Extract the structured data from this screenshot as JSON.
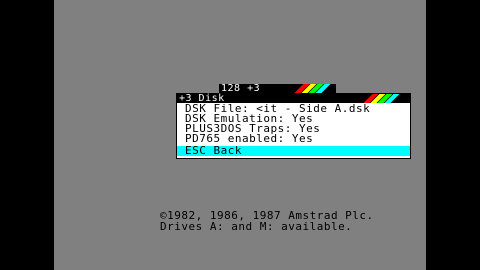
{
  "tab": {
    "label": "128 +3"
  },
  "menu": {
    "title": "+3 Disk",
    "items": [
      {
        "label": "DSK File: <it - Side A.dsk"
      },
      {
        "label": "DSK Emulation: Yes"
      },
      {
        "label": "PLUS3DOS Traps: Yes"
      },
      {
        "label": "PD765 enabled: Yes"
      }
    ],
    "selected": {
      "label": "ESC Back"
    }
  },
  "footer": {
    "line1": "©1982, 1986, 1987 Amstrad Plc.",
    "line2": "Drives A: and M: available."
  },
  "colors": {
    "stripes": [
      "#ff0000",
      "#ffff00",
      "#00ff00",
      "#00ffff"
    ],
    "highlight": "#00ffff",
    "screen": "#808080"
  }
}
